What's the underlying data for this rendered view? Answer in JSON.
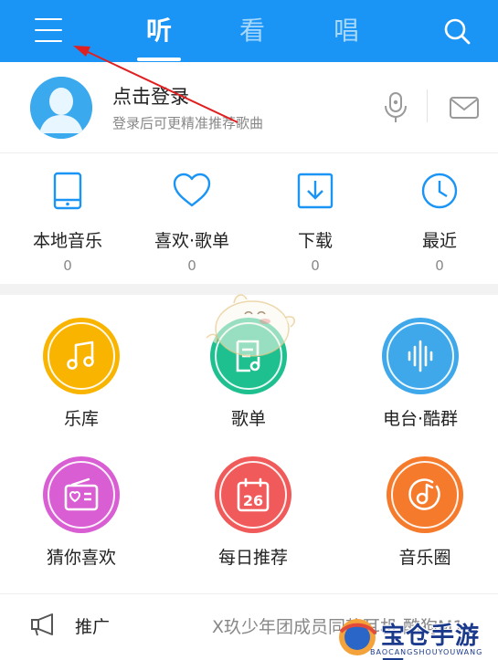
{
  "tabs": [
    {
      "label": "听",
      "active": true
    },
    {
      "label": "看",
      "active": false
    },
    {
      "label": "唱",
      "active": false
    }
  ],
  "icons": {
    "menu": "menu-icon",
    "search": "search-icon",
    "mic": "microphone-icon",
    "mail": "mail-icon"
  },
  "colors": {
    "topbar": "#1a95f5",
    "accent": "#1a95f5",
    "music_library": "#f9b400",
    "playlist": "#1fc08f",
    "radio": "#3ea8ea",
    "guess_you_like": "#d95ed3",
    "daily_recommend": "#f05a5a",
    "music_circle": "#f57a2c",
    "annotation_arrow": "#e02020"
  },
  "profile": {
    "title": "点击登录",
    "subtitle": "登录后可更精准推荐歌曲"
  },
  "quick": [
    {
      "label": "本地音乐",
      "count": "0",
      "icon": "phone-icon"
    },
    {
      "label": "喜欢·歌单",
      "count": "0",
      "icon": "heart-icon"
    },
    {
      "label": "下载",
      "count": "0",
      "icon": "download-icon"
    },
    {
      "label": "最近",
      "count": "0",
      "icon": "clock-icon"
    }
  ],
  "grid": [
    {
      "label": "乐库",
      "icon": "music-note-icon"
    },
    {
      "label": "歌单",
      "icon": "playlist-icon"
    },
    {
      "label": "电台·酷群",
      "icon": "sound-wave-icon"
    },
    {
      "label": "猜你喜欢",
      "icon": "radio-heart-icon"
    },
    {
      "label": "每日推荐",
      "icon": "calendar-icon",
      "calendar_day": "26"
    },
    {
      "label": "音乐圈",
      "icon": "music-disc-icon"
    }
  ],
  "promo": {
    "label": "推广",
    "text": "X玖少年团成员同款耳机 酷狗M1"
  },
  "watermark": {
    "title": "宝仓手游网",
    "subtitle": "BAOCANGSHOUYOUWANG"
  }
}
